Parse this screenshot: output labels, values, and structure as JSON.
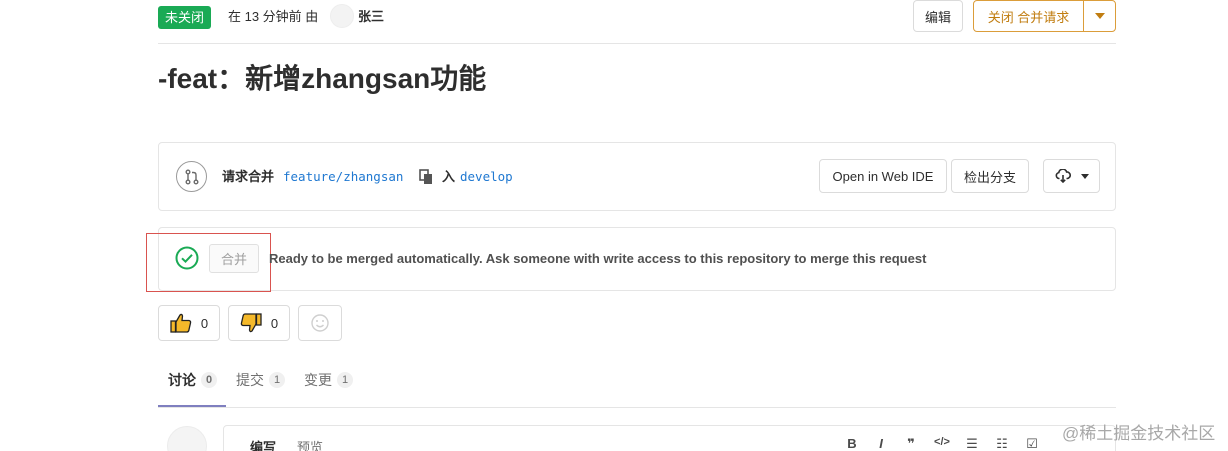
{
  "header": {
    "status_badge": "未关闭",
    "meta_text": "在 13 分钟前 由",
    "author": "张三",
    "edit_label": "编辑",
    "close_label": "关闭 合并请求"
  },
  "title": "-feat：新增zhangsan功能",
  "branch_info": {
    "request_label": "请求合并",
    "source_branch": "feature/zhangsan",
    "into_label": "入",
    "target_branch": "develop",
    "web_ide_label": "Open in Web IDE",
    "checkout_label": "检出分支"
  },
  "merge_widget": {
    "merge_button_label": "合并",
    "message": "Ready to be merged automatically. Ask someone with write access to this repository to merge this request"
  },
  "awards": {
    "thumbs_up_count": "0",
    "thumbs_down_count": "0"
  },
  "tabs": [
    {
      "label": "讨论",
      "count": "0"
    },
    {
      "label": "提交",
      "count": "1"
    },
    {
      "label": "变更",
      "count": "1"
    }
  ],
  "editor": {
    "write_tab": "编写",
    "preview_tab": "预览",
    "toolbar": [
      "B",
      "I",
      "❞",
      "</>",
      "☰",
      "☷",
      "☑"
    ]
  },
  "watermark": "@稀土掘金技术社区",
  "colors": {
    "open_badge": "#1aaa55",
    "close_accent": "#db9d3a",
    "link": "#1f78d1",
    "success": "#1aaa55",
    "highlight_frame": "#d9534f"
  }
}
